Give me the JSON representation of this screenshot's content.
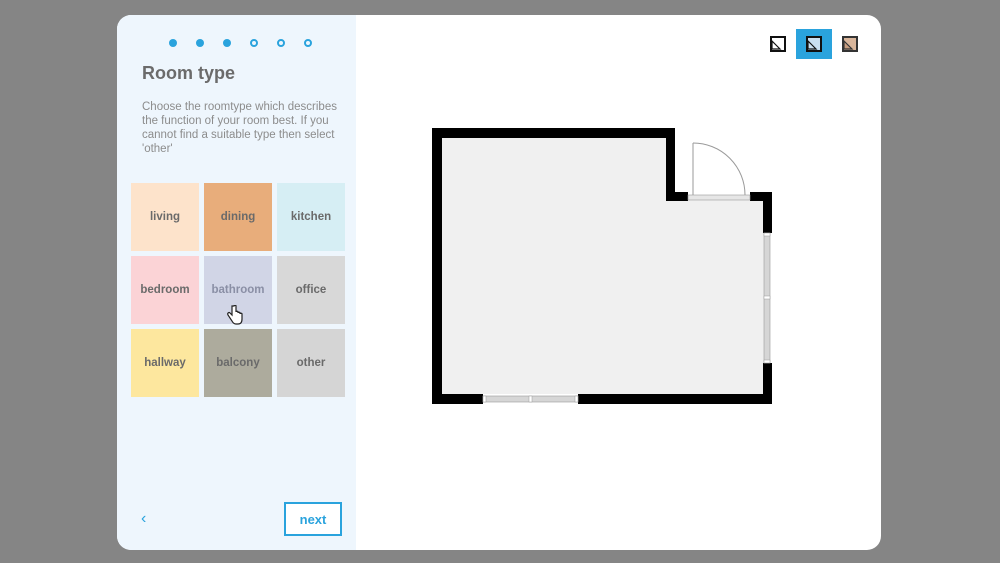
{
  "wizard": {
    "steps_total": 6,
    "steps_completed": 3,
    "title": "Room type",
    "description": "Choose the roomtype which describes the function of your room best. If you cannot find a suitable type then select 'other'",
    "room_types": [
      {
        "label": "living",
        "color": "#fde3cb"
      },
      {
        "label": "dining",
        "color": "#e8ad7b"
      },
      {
        "label": "kitchen",
        "color": "#d6eef4"
      },
      {
        "label": "bedroom",
        "color": "#fbd3d6"
      },
      {
        "label": "bathroom",
        "color": "#d1d5e6"
      },
      {
        "label": "office",
        "color": "#d8d8d8"
      },
      {
        "label": "hallway",
        "color": "#fde79e"
      },
      {
        "label": "balcony",
        "color": "#adab9d"
      },
      {
        "label": "other",
        "color": "#d5d5d5"
      }
    ],
    "hovered": "bathroom",
    "back_label": "‹",
    "next_label": "next"
  },
  "view_modes": [
    {
      "name": "view-mode-outline-icon",
      "active": false
    },
    {
      "name": "view-mode-filled-icon",
      "active": true
    },
    {
      "name": "view-mode-textured-icon",
      "active": false
    }
  ],
  "colors": {
    "accent": "#2aa3dd",
    "wall": "#000000",
    "floor": "#f0f0f0"
  }
}
